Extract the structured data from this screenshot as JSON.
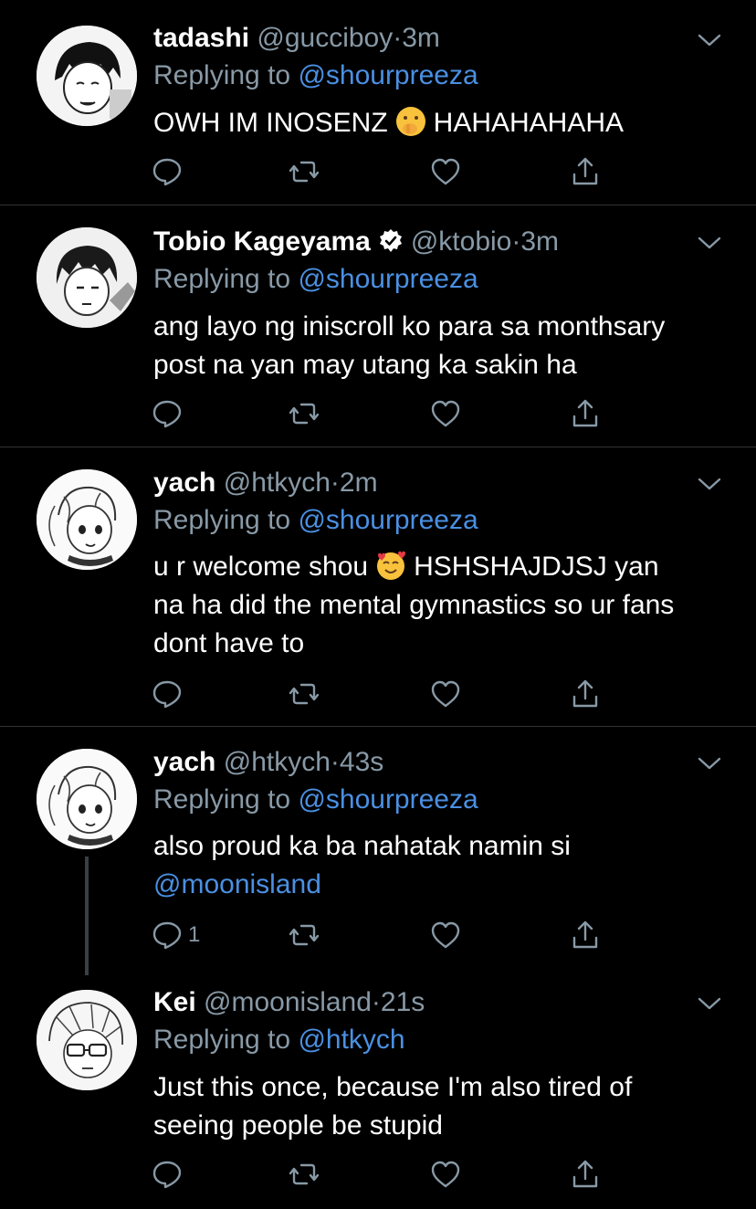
{
  "theme": {
    "background": "#000000",
    "link": "#4a90e2",
    "muted": "#8899a6",
    "divider": "#2f3336"
  },
  "tweets": [
    {
      "name": "tadashi",
      "handle": "@gucciboy",
      "dot": "·",
      "time": "3m",
      "replying_prefix": "Replying to ",
      "replying_to": "@shourpreeza",
      "body_lines": [
        "OWH IM INOSENZ",
        "HAHAHAHAHA"
      ],
      "emoji": "shushing-face",
      "reply_count": ""
    },
    {
      "name": "Tobio Kageyama",
      "verified": true,
      "handle": "@ktobio",
      "dot": "·",
      "time": "3m",
      "replying_prefix": "Replying to ",
      "replying_to": "@shourpreeza",
      "body_lines": [
        "ang layo ng iniscroll ko para sa monthsary",
        "post na yan may utang ka sakin ha"
      ],
      "reply_count": ""
    },
    {
      "name": "yach",
      "handle": "@htkych",
      "dot": "·",
      "time": "2m",
      "replying_prefix": "Replying to ",
      "replying_to": "@shourpreeza",
      "body_lines": [
        "u r welcome shou",
        "HSHSHAJDJSJ yan",
        "na ha did the mental gymnastics so ur fans",
        "dont have to"
      ],
      "emoji": "smiling-face-with-hearts",
      "reply_count": ""
    },
    {
      "name": "yach",
      "handle": "@htkych",
      "dot": "·",
      "time": "43s",
      "replying_prefix": "Replying to ",
      "replying_to": "@shourpreeza",
      "body_lines": [
        "also proud ka ba nahatak namin si"
      ],
      "body_mention": "@moonisland",
      "reply_count": "1"
    },
    {
      "name": "Kei",
      "handle": "@moonisland",
      "dot": "·",
      "time": "21s",
      "replying_prefix": "Replying to ",
      "replying_to": "@htkych",
      "body_lines": [
        "Just this once, because I'm also tired of",
        "seeing people be stupid"
      ],
      "reply_count": ""
    }
  ]
}
